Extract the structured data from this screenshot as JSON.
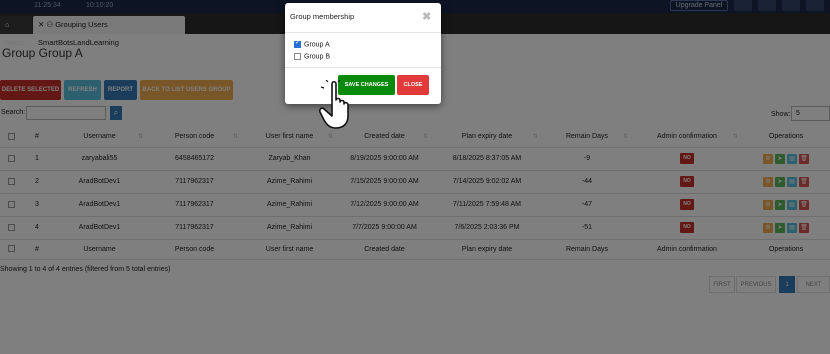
{
  "topbar": {
    "time1": "11:25:34",
    "time2": "10:10:20",
    "upgrade_label": "Upgrade Panel"
  },
  "tabs": {
    "home": "Home",
    "active": "Grouping Users SmartBotsLandLearning"
  },
  "page": {
    "title": "Group Group A"
  },
  "toolbar": {
    "delete_label": "DELETE SELECTED",
    "refresh_label": "REFRESH",
    "report_label": "REPORT",
    "back_label": "BACK TO LIST USERS GROUP"
  },
  "search": {
    "label": "Search:",
    "value": ""
  },
  "show": {
    "label": "Show:",
    "value": "5"
  },
  "table": {
    "headers": [
      "#",
      "Username",
      "Person code",
      "User first name",
      "Created date",
      "Plan expiry date",
      "Remain Days",
      "Admin confirmation",
      "Operations"
    ],
    "rows": [
      {
        "num": "1",
        "username": "zaryabali55",
        "person_code": "6458465172",
        "first_name": "Zaryab_Khan",
        "created": "8/19/2025 9:00:00 AM",
        "expiry": "8/18/2025 8:37:05 AM",
        "remain": "-9",
        "confirm": "NO"
      },
      {
        "num": "2",
        "username": "AradBotDev1",
        "person_code": "7117962317",
        "first_name": "Azime_Rahimi",
        "created": "7/15/2025 9:00:00 AM",
        "expiry": "7/14/2025 9:02:02 AM",
        "remain": "-44",
        "confirm": "NO"
      },
      {
        "num": "3",
        "username": "AradBotDev1",
        "person_code": "7117962317",
        "first_name": "Azime_Rahimi",
        "created": "7/12/2025 9:00:00 AM",
        "expiry": "7/11/2025 7:59:48 AM",
        "remain": "-47",
        "confirm": "NO"
      },
      {
        "num": "4",
        "username": "AradBotDev1",
        "person_code": "7117962317",
        "first_name": "Azime_Rahimi",
        "created": "7/7/2025 9:00:00 AM",
        "expiry": "7/6/2025 2:03:36 PM",
        "remain": "-51",
        "confirm": "NO"
      }
    ]
  },
  "footer": {
    "entries": "Showing 1 to 4 of 4 entries (filtered from 5 total entries)"
  },
  "pager": {
    "first": "FIRST",
    "previous": "PREVIOUS",
    "current": "1",
    "next": "NEXT"
  },
  "modal": {
    "title": "Group membership",
    "options": [
      {
        "label": "Group A",
        "checked": true
      },
      {
        "label": "Group B",
        "checked": false
      }
    ],
    "save_label": "SAVE CHANGES",
    "close_label": "CLOSE"
  },
  "colors": {
    "save": "#0a8a0a",
    "close": "#e23a3a",
    "no_badge": "#c9302c",
    "primary": "#337ab7"
  }
}
